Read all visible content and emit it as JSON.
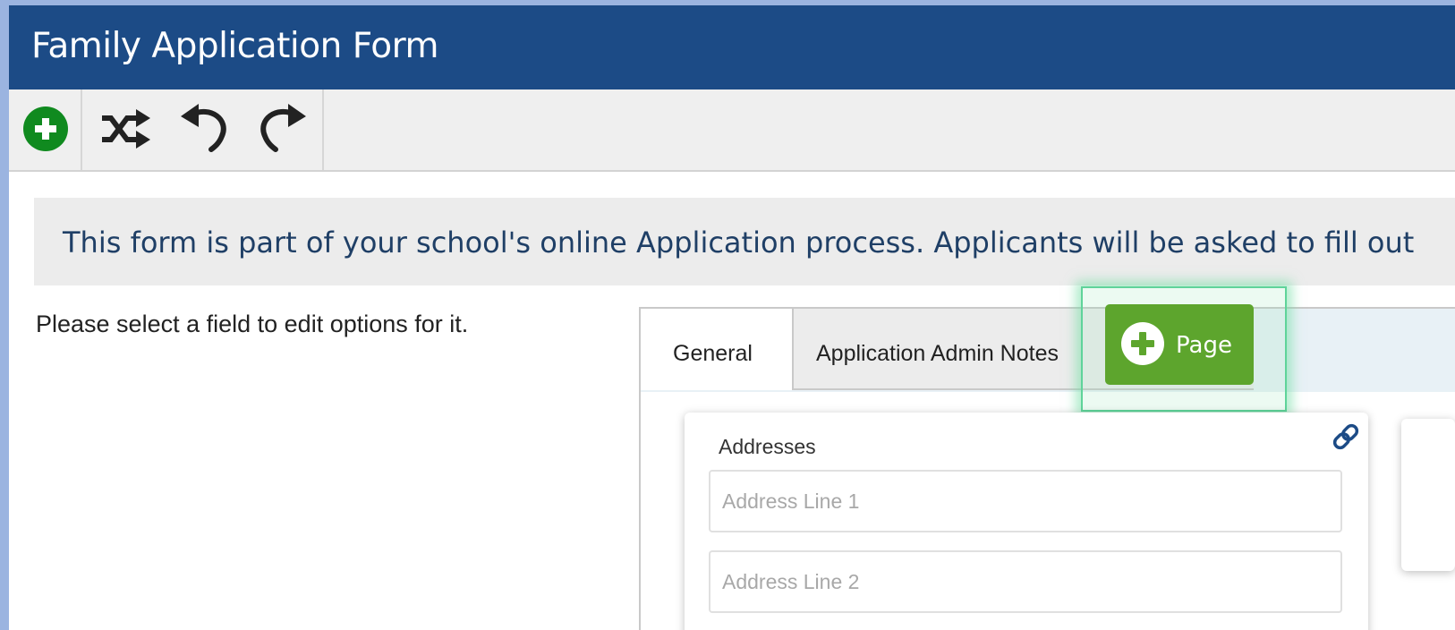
{
  "window": {
    "title": "Family Application Form"
  },
  "toolbar": {
    "buttons": [
      {
        "icon": "add-circle-icon",
        "color": "#108a1f"
      },
      {
        "icon": "shuffle-icon"
      },
      {
        "icon": "undo-icon"
      },
      {
        "icon": "redo-icon"
      }
    ]
  },
  "banner": {
    "text": "This form is part of your school's online Application process. Applicants will be asked to fill out"
  },
  "hint": {
    "text": "Please select a field to edit options for it."
  },
  "tabs": {
    "items": [
      {
        "label": "General",
        "active": true
      },
      {
        "label": "Application Admin Notes",
        "active": false
      }
    ],
    "add_page_label": "Page",
    "add_page_color": "#5da52d"
  },
  "card": {
    "label": "Addresses",
    "fields": [
      {
        "placeholder": "Address Line 1",
        "value": ""
      },
      {
        "placeholder": "Address Line 2",
        "value": ""
      }
    ]
  },
  "colors": {
    "header": "#1c4b86",
    "banner_text": "#1f3f66",
    "link_icon": "#1c4b86"
  }
}
